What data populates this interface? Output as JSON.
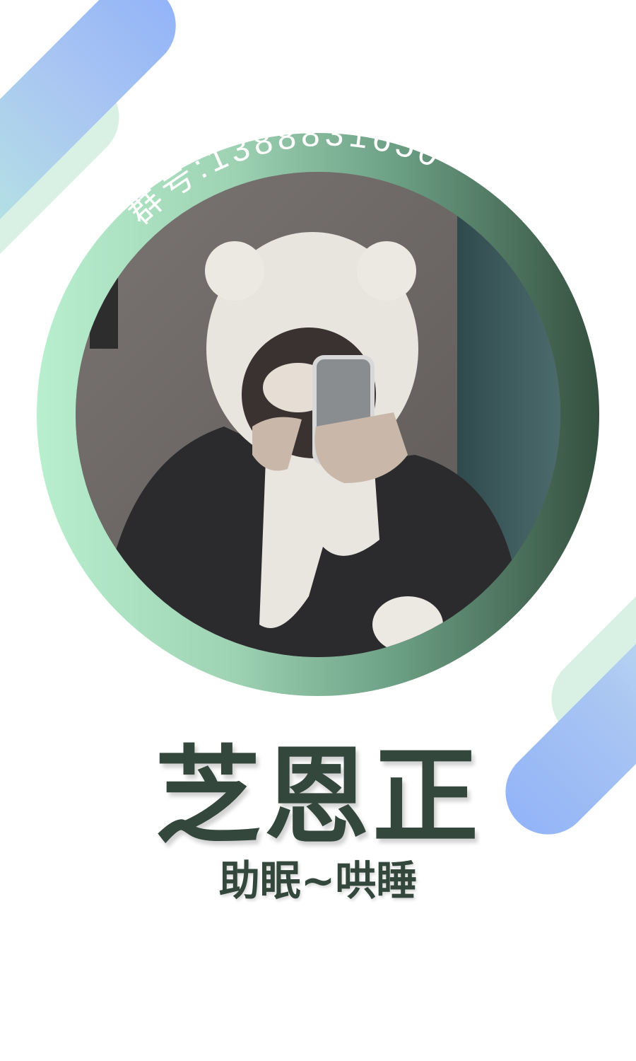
{
  "profile": {
    "group_label": "群号:1388831650",
    "name": "芝恩正",
    "tagline": "助眠~哄睡"
  },
  "photo": {
    "description_icon": "person-bear-hood-photo"
  },
  "colors": {
    "ring_light": "#b8efcf",
    "ring_dark": "#35503f",
    "text_dark": "#34473c",
    "accent_blue": "#93b4f7",
    "accent_green": "#d9f0e4"
  }
}
